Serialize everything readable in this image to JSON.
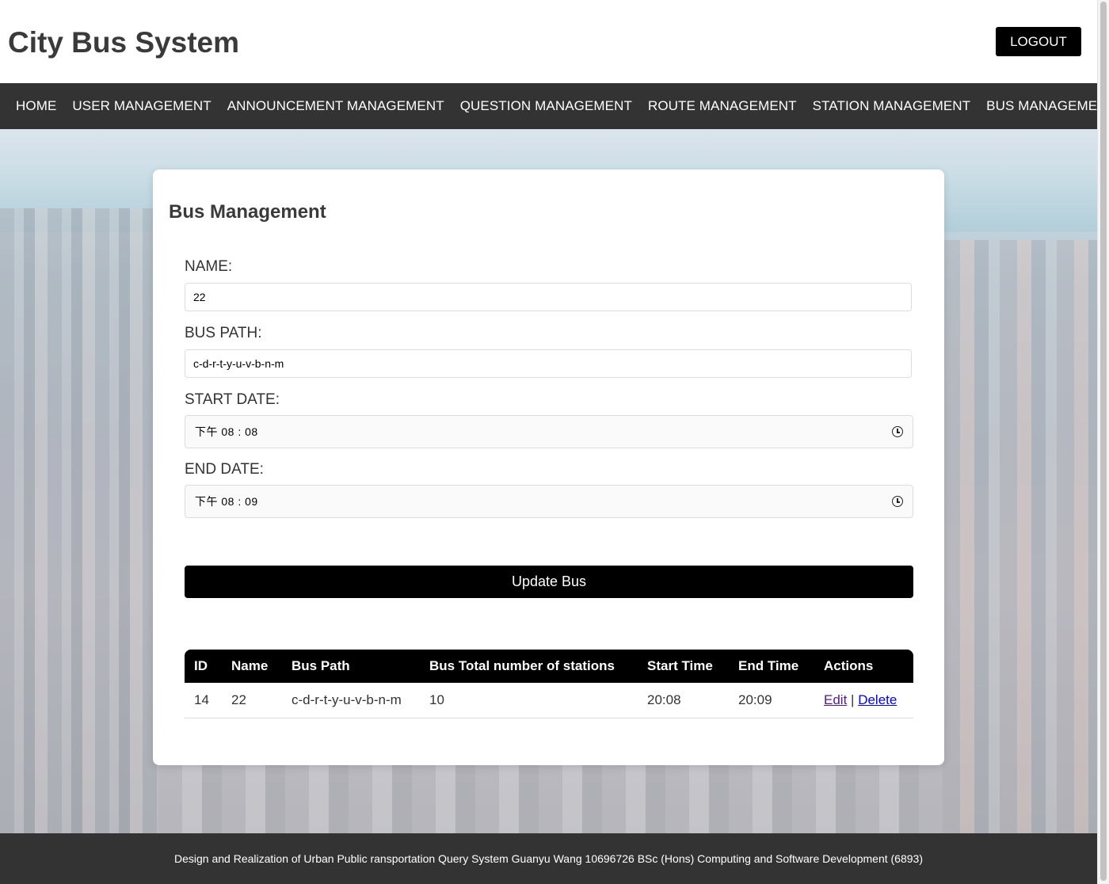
{
  "header": {
    "title": "City Bus System",
    "logout_label": "LOGOUT"
  },
  "nav": {
    "items": [
      {
        "label": "HOME"
      },
      {
        "label": "USER MANAGEMENT"
      },
      {
        "label": "ANNOUNCEMENT MANAGEMENT"
      },
      {
        "label": "QUESTION MANAGEMENT"
      },
      {
        "label": "ROUTE MANAGEMENT"
      },
      {
        "label": "STATION MANAGEMENT"
      },
      {
        "label": "BUS MANAGEMENT"
      }
    ]
  },
  "form": {
    "heading": "Bus Management",
    "name_label": "NAME:",
    "name_value": "22",
    "path_label": "BUS PATH:",
    "path_value": "c-d-r-t-y-u-v-b-n-m",
    "start_label": "START DATE:",
    "start_value": "下午 08 : 08",
    "end_label": "END DATE:",
    "end_value": "下午 08 : 09",
    "submit_label": "Update Bus"
  },
  "table": {
    "headers": [
      "ID",
      "Name",
      "Bus Path",
      "Bus Total number of stations",
      "Start Time",
      "End Time",
      "Actions"
    ],
    "rows": [
      {
        "id": "14",
        "name": "22",
        "path": "c-d-r-t-y-u-v-b-n-m",
        "stations": "10",
        "start": "20:08",
        "end": "20:09",
        "edit": "Edit",
        "separator": "|",
        "delete": "Delete"
      }
    ]
  },
  "footer": {
    "text": "Design and Realization of Urban Public ransportation Query System Guanyu Wang 10696726 BSc (Hons) Computing and Software Development (6893)"
  }
}
